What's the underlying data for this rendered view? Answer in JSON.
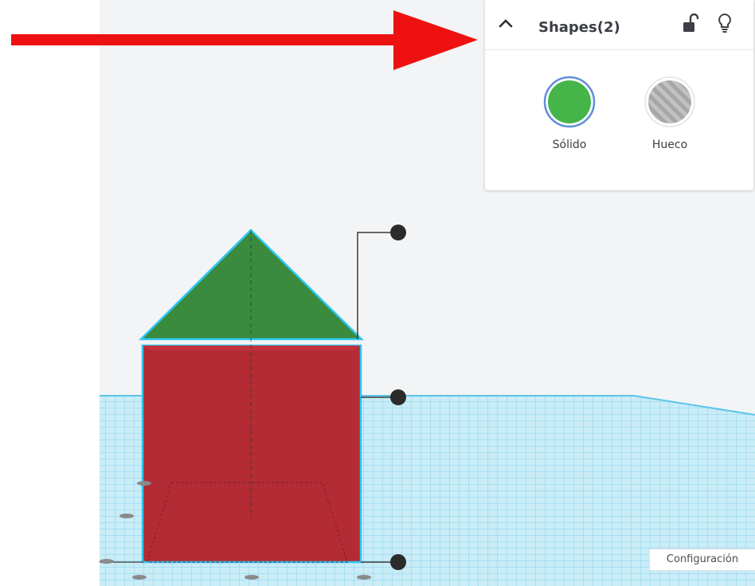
{
  "panel": {
    "title": "Shapes(2)",
    "collapse_icon": "chevron-up-icon",
    "lock_icon": "unlock-icon",
    "bulb_icon": "lightbulb-icon",
    "options": [
      {
        "label": "Sólido",
        "color": "#45b449",
        "selected": true
      },
      {
        "label": "Hueco",
        "color": "#a6a6a6",
        "selected": false
      }
    ]
  },
  "settings": {
    "label": "Configuración"
  },
  "scene": {
    "grid_color": "#7fd0ec",
    "roof_color": "#3b8b3f",
    "box_color": "#b22b35",
    "selection_color": "#2fc7f2",
    "annotation_color": "#ee1111"
  }
}
